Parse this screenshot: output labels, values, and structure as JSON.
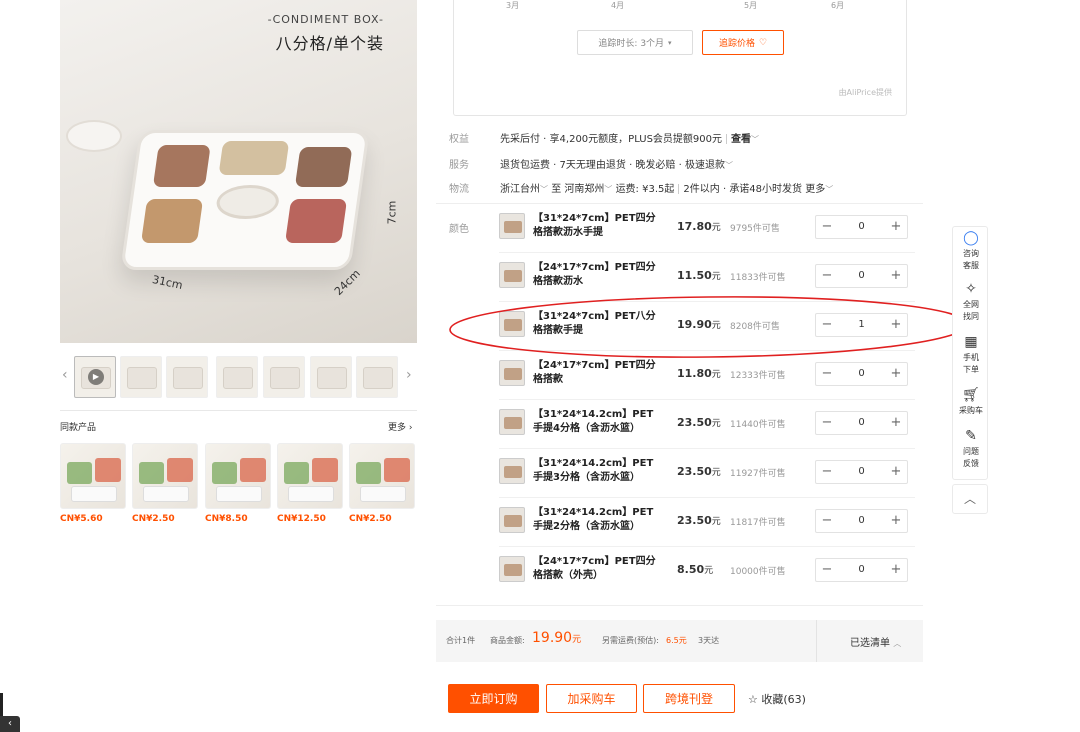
{
  "hero": {
    "tag": "-CONDIMENT BOX-",
    "headline": "八分格/单个装",
    "dims": {
      "w": "31cm",
      "d": "24cm",
      "h": "7cm"
    }
  },
  "similar": {
    "title": "同款产品",
    "more": "更多 ›",
    "prices": [
      "CN¥5.60",
      "CN¥2.50",
      "CN¥8.50",
      "CN¥12.50",
      "CN¥2.50"
    ]
  },
  "trend": {
    "months": [
      "3月",
      "4月",
      "5月",
      "6月"
    ],
    "period_label": "追踪时长: 3个月",
    "track_label": "追踪价格",
    "credit": "由AliPrice提供"
  },
  "info": {
    "rights_label": "权益",
    "rights_value": "先采后付 · 享4,200元额度，PLUS会员提额900元",
    "rights_link": "查看",
    "service_label": "服务",
    "service_value": "退货包运费 · 7天无理由退货 · 晚发必赔 · 极速退款",
    "logistics_label": "物流",
    "logistics_from": "浙江台州",
    "logistics_to_word": "至",
    "logistics_to": "河南郑州",
    "logistics_fee": "运费: ¥3.5起",
    "logistics_qty": "2件以内",
    "logistics_promise": "承诺48小时发货",
    "logistics_more": "更多",
    "color_label": "颜色"
  },
  "skus": [
    {
      "name": "【31*24*7cm】PET四分格搭款沥水手提",
      "price": "17.80",
      "unit": "元",
      "stock": "9795件可售",
      "qty": "0"
    },
    {
      "name": "【24*17*7cm】PET四分格搭款沥水",
      "price": "11.50",
      "unit": "元",
      "stock": "11833件可售",
      "qty": "0"
    },
    {
      "name": "【31*24*7cm】PET八分格搭款手提",
      "price": "19.90",
      "unit": "元",
      "stock": "8208件可售",
      "qty": "1"
    },
    {
      "name": "【24*17*7cm】PET四分格搭款",
      "price": "11.80",
      "unit": "元",
      "stock": "12333件可售",
      "qty": "0"
    },
    {
      "name": "【31*24*14.2cm】PET手提4分格（含沥水篮）",
      "price": "23.50",
      "unit": "元",
      "stock": "11440件可售",
      "qty": "0"
    },
    {
      "name": "【31*24*14.2cm】PET手提3分格（含沥水篮）",
      "price": "23.50",
      "unit": "元",
      "stock": "11927件可售",
      "qty": "0"
    },
    {
      "name": "【31*24*14.2cm】PET手提2分格（含沥水篮）",
      "price": "23.50",
      "unit": "元",
      "stock": "11817件可售",
      "qty": "0"
    },
    {
      "name": "【24*17*7cm】PET四分格搭款（外壳）",
      "price": "8.50",
      "unit": "元",
      "stock": "10000件可售",
      "qty": "0"
    }
  ],
  "summary": {
    "count": "合计1件",
    "goods_label": "商品金额:",
    "goods_amount": "19.90",
    "goods_unit": "元",
    "freight_label": "另需运费(预估):",
    "freight_amount": "6.5",
    "freight_unit": "元",
    "days": "3天达",
    "chosen": "已选清单"
  },
  "actions": {
    "buy": "立即订购",
    "cart": "加采购车",
    "cross": "跨境刊登",
    "fav": "收藏(63)"
  },
  "side": {
    "consult": "咨询客服",
    "find_same": "全网找同款",
    "phone": "手机下单",
    "cart": "采购车",
    "feedback": "问题反馈"
  },
  "colors": {
    "accent": "#ff5000",
    "annotation": "#e02020"
  }
}
